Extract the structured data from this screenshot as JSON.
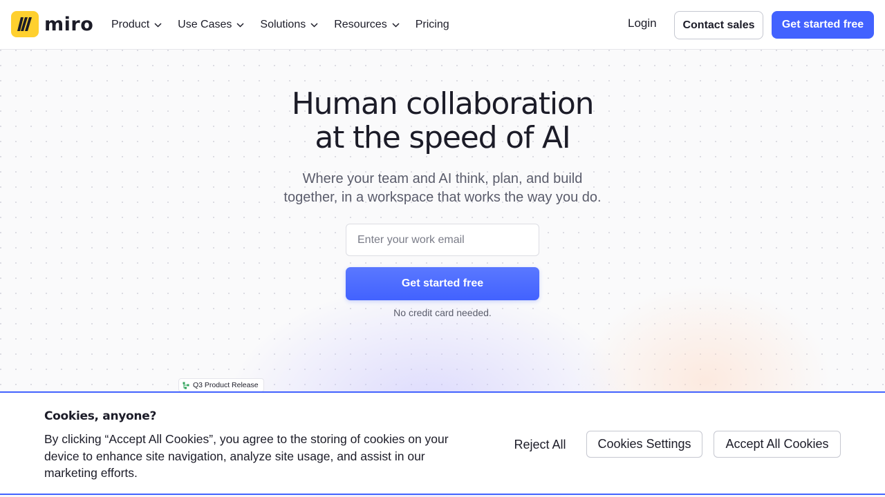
{
  "brand": {
    "name": "miro",
    "logo_color": "#ffd02f"
  },
  "nav": {
    "items": [
      {
        "label": "Product",
        "has_dropdown": true
      },
      {
        "label": "Use Cases",
        "has_dropdown": true
      },
      {
        "label": "Solutions",
        "has_dropdown": true
      },
      {
        "label": "Resources",
        "has_dropdown": true
      },
      {
        "label": "Pricing",
        "has_dropdown": false
      }
    ],
    "login_label": "Login",
    "contact_sales_label": "Contact sales",
    "get_started_label": "Get started free"
  },
  "hero": {
    "title_line1": "Human collaboration",
    "title_line2": "at the speed of AI",
    "subtitle_line1": "Where your team and AI think, plan, and build",
    "subtitle_line2": "together, in a workspace that works the way you do.",
    "email_placeholder": "Enter your work email",
    "email_value": "",
    "cta_label": "Get started free",
    "note": "No credit card needed."
  },
  "board_preview": {
    "tag_label": "Q3 Product Release"
  },
  "cookie_banner": {
    "title": "Cookies, anyone?",
    "text_line1": "By clicking “Accept All Cookies”, you agree to the storing of cookies on your",
    "text_line2": "device to enhance site navigation, analyze site usage, and assist in our",
    "text_line3": "marketing efforts.",
    "reject_label": "Reject All",
    "settings_label": "Cookies Settings",
    "accept_label": "Accept All Cookies"
  },
  "colors": {
    "accent": "#4262ff",
    "text": "#1c1c28",
    "muted": "#5a5c6b"
  },
  "icons": {
    "logo": "miro-logo-icon",
    "chevron": "chevron-down-icon",
    "tag": "flow-icon"
  }
}
